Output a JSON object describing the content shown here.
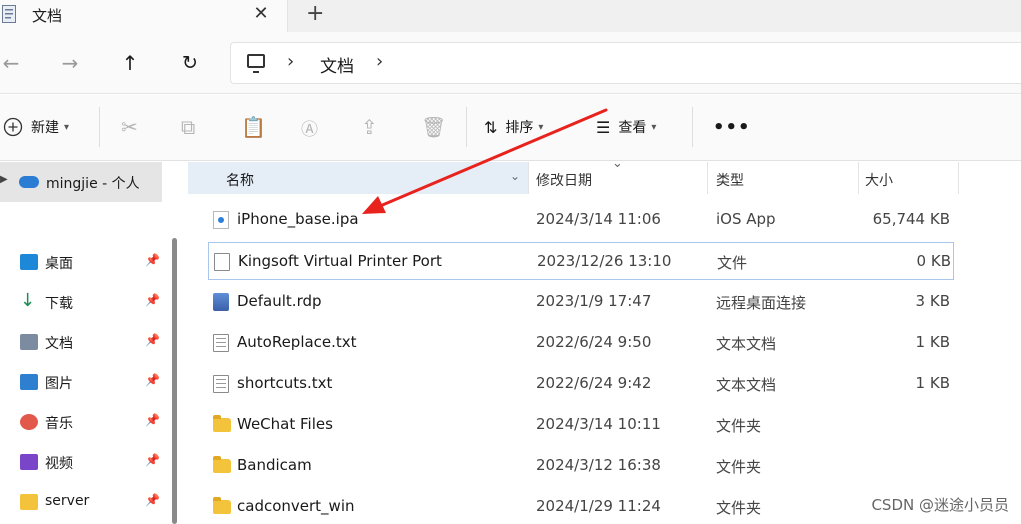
{
  "tab": {
    "title": "文档"
  },
  "address": {
    "location": "文档"
  },
  "toolbar": {
    "new_label": "新建",
    "sort_label": "排序",
    "view_label": "查看"
  },
  "sidebar": {
    "onedrive_label": "mingjie - 个人",
    "items": [
      {
        "label": "桌面",
        "color": "#1e88d8"
      },
      {
        "label": "下载",
        "color": "#1d8b55"
      },
      {
        "label": "文档",
        "color": "#7d8ba0"
      },
      {
        "label": "图片",
        "color": "#2f7fd0"
      },
      {
        "label": "音乐",
        "color": "#e2584a"
      },
      {
        "label": "视频",
        "color": "#7a45c8"
      },
      {
        "label": "server",
        "color": "#f3c33c"
      }
    ]
  },
  "columns": {
    "name": "名称",
    "date": "修改日期",
    "type": "类型",
    "size": "大小"
  },
  "files": [
    {
      "name": "iPhone_base.ipa",
      "date": "2024/3/14 11:06",
      "type": "iOS App",
      "size": "65,744 KB",
      "icon": "ipa"
    },
    {
      "name": "Kingsoft Virtual Printer Port",
      "date": "2023/12/26 13:10",
      "type": "文件",
      "size": "0 KB",
      "icon": "file"
    },
    {
      "name": "Default.rdp",
      "date": "2023/1/9 17:47",
      "type": "远程桌面连接",
      "size": "3 KB",
      "icon": "rdp"
    },
    {
      "name": "AutoReplace.txt",
      "date": "2022/6/24 9:50",
      "type": "文本文档",
      "size": "1 KB",
      "icon": "txt"
    },
    {
      "name": "shortcuts.txt",
      "date": "2022/6/24 9:42",
      "type": "文本文档",
      "size": "1 KB",
      "icon": "txt"
    },
    {
      "name": "WeChat Files",
      "date": "2024/3/14 10:11",
      "type": "文件夹",
      "size": "",
      "icon": "folder"
    },
    {
      "name": "Bandicam",
      "date": "2024/3/12 16:38",
      "type": "文件夹",
      "size": "",
      "icon": "folder"
    },
    {
      "name": "cadconvert_win",
      "date": "2024/1/29 11:24",
      "type": "文件夹",
      "size": "",
      "icon": "folder"
    }
  ],
  "watermark": "CSDN @迷途小员员",
  "annotation_color": "#e8231e"
}
